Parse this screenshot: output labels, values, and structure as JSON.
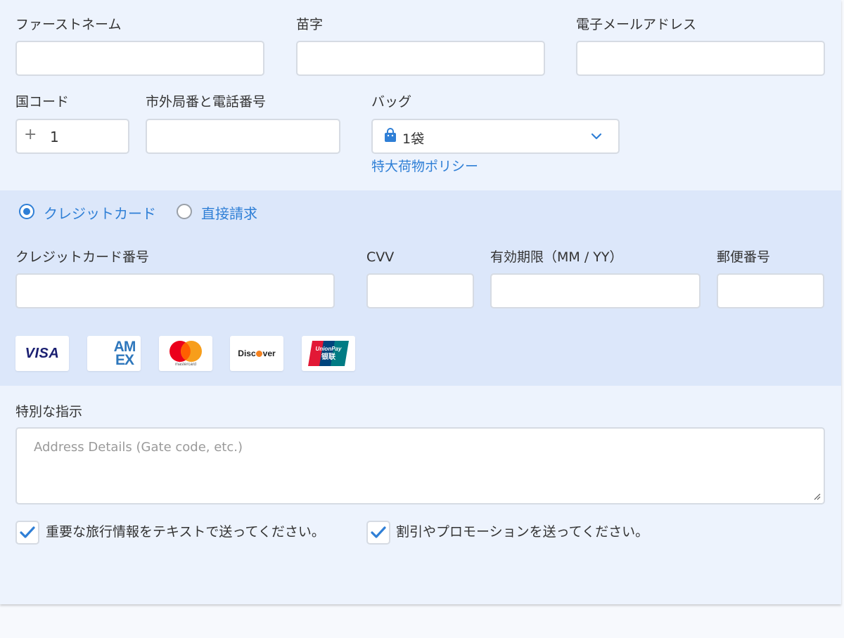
{
  "contact": {
    "first_name_label": "ファーストネーム",
    "last_name_label": "苗字",
    "email_label": "電子メールアドレス",
    "country_code_label": "国コード",
    "country_code_prefix": "+",
    "country_code_value": "1",
    "phone_label": "市外局番と電話番号",
    "bag_label": "バッグ",
    "bag_value": "1袋",
    "oversize_policy_link": "特大荷物ポリシー"
  },
  "payment": {
    "method_credit": "クレジットカード",
    "method_direct": "直接請求",
    "selected_method": "クレジットカード",
    "card_number_label": "クレジットカード番号",
    "cvv_label": "CVV",
    "expiry_label": "有効期限（MM / YY）",
    "zip_label": "郵便番号",
    "card_logos": {
      "visa": "VISA",
      "amex_top": "AM",
      "amex_bottom": "EX",
      "mastercard": "mastercard",
      "discover_left": "Disc",
      "discover_right": "ver",
      "unionpay_top": "UnionPay",
      "unionpay_bottom": "银联"
    }
  },
  "instructions": {
    "label": "特別な指示",
    "placeholder": "Address Details (Gate code, etc.)"
  },
  "options": {
    "travel_sms_label": "重要な旅行情報をテキストで送ってください。",
    "travel_sms_checked": true,
    "promotions_label": "割引やプロモーションを送ってください。",
    "promotions_checked": true
  },
  "colors": {
    "accent": "#2f7fd6",
    "panel_bg": "#edf3fd",
    "payment_band_bg": "#dce7fa",
    "visa_blue": "#1a1f71",
    "amex_blue": "#2e77bc",
    "mc_red": "#eb001b",
    "mc_orange": "#f79e1b",
    "discover_orange": "#f58220",
    "unionpay_red": "#e21836",
    "unionpay_blue": "#00447c",
    "unionpay_green": "#007b84"
  }
}
